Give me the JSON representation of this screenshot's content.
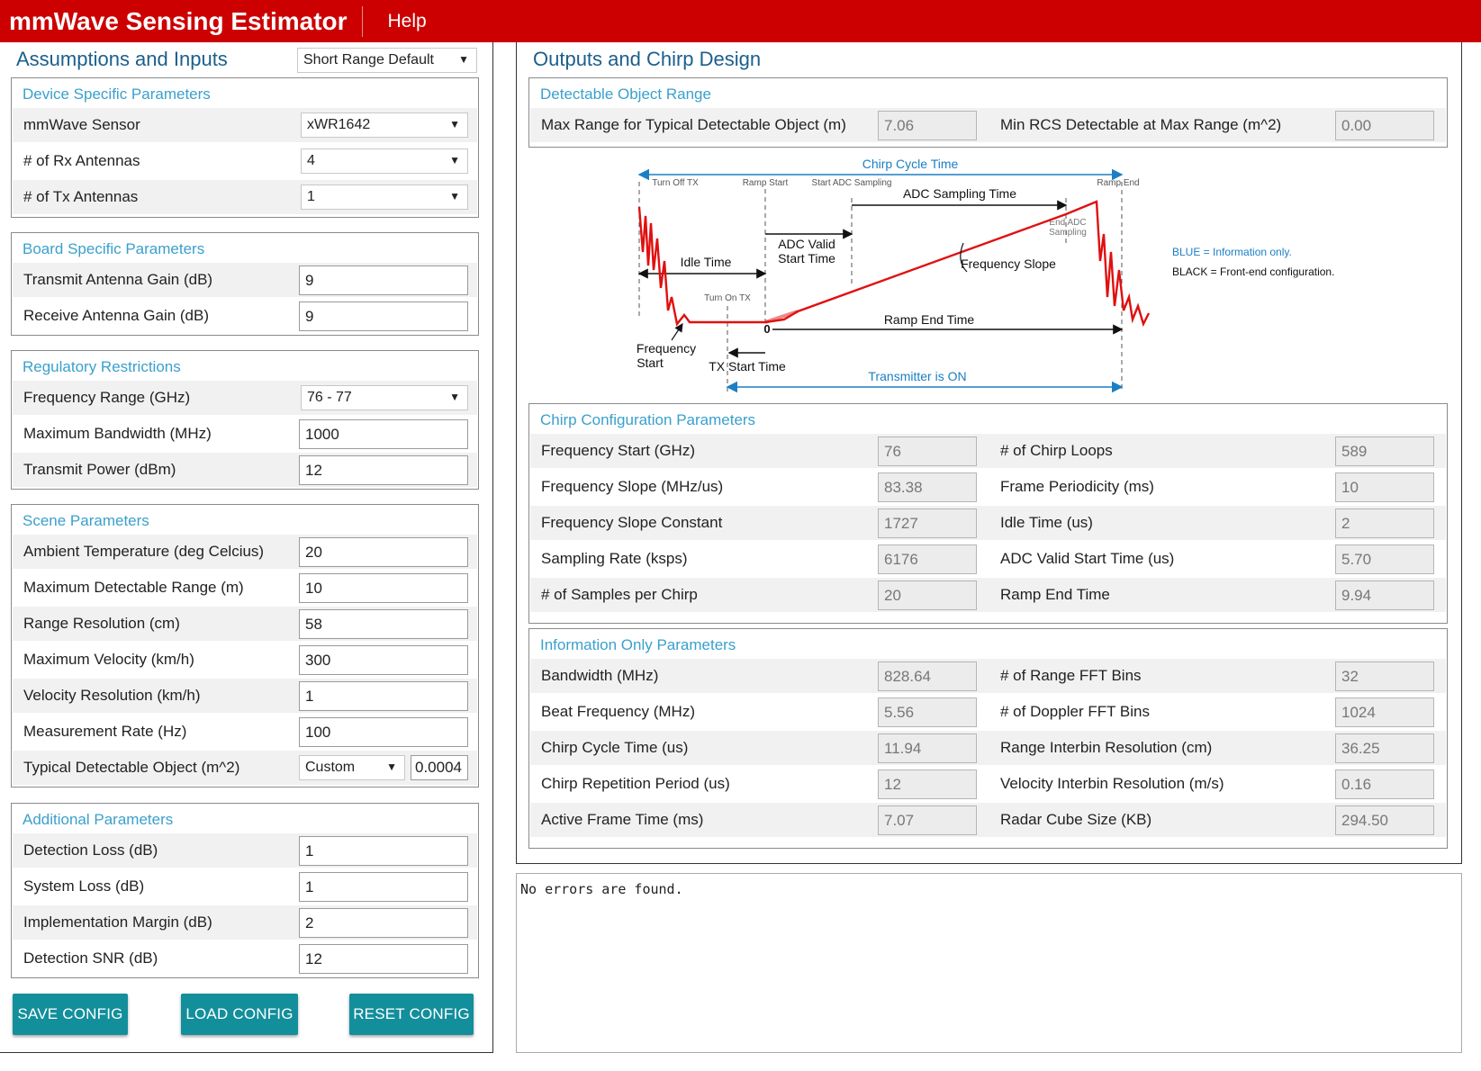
{
  "header": {
    "title": "mmWave Sensing Estimator",
    "help": "Help"
  },
  "left": {
    "title": "Assumptions and Inputs",
    "preset": "Short Range Default",
    "device": {
      "title": "Device Specific Parameters",
      "sensor_label": "mmWave Sensor",
      "sensor_value": "xWR1642",
      "rx_label": "# of Rx Antennas",
      "rx_value": "4",
      "tx_label": "# of Tx Antennas",
      "tx_value": "1"
    },
    "board": {
      "title": "Board Specific Parameters",
      "tx_gain_label": "Transmit Antenna Gain (dB)",
      "tx_gain_value": "9",
      "rx_gain_label": "Receive Antenna Gain (dB)",
      "rx_gain_value": "9"
    },
    "regulatory": {
      "title": "Regulatory Restrictions",
      "freq_label": "Frequency Range (GHz)",
      "freq_value": "76 - 77",
      "bw_label": "Maximum Bandwidth (MHz)",
      "bw_value": "1000",
      "power_label": "Transmit Power (dBm)",
      "power_value": "12"
    },
    "scene": {
      "title": "Scene Parameters",
      "temp_label": "Ambient Temperature (deg Celcius)",
      "temp_value": "20",
      "range_label": "Maximum Detectable Range (m)",
      "range_value": "10",
      "res_label": "Range Resolution (cm)",
      "res_value": "58",
      "vel_label": "Maximum Velocity (km/h)",
      "vel_value": "300",
      "velres_label": "Velocity Resolution (km/h)",
      "velres_value": "1",
      "rate_label": "Measurement Rate (Hz)",
      "rate_value": "100",
      "object_label": "Typical Detectable Object (m^2)",
      "object_select": "Custom",
      "object_value": "0.0004"
    },
    "additional": {
      "title": "Additional Parameters",
      "detloss_label": "Detection Loss (dB)",
      "detloss_value": "1",
      "sysloss_label": "System Loss (dB)",
      "sysloss_value": "1",
      "impl_label": "Implementation Margin (dB)",
      "impl_value": "2",
      "snr_label": "Detection SNR (dB)",
      "snr_value": "12"
    },
    "buttons": {
      "save": "SAVE CONFIG",
      "load": "LOAD CONFIG",
      "reset": "RESET CONFIG"
    }
  },
  "right": {
    "title": "Outputs and Chirp Design",
    "detectable": {
      "title": "Detectable Object Range",
      "maxrange_label": "Max Range for Typical Detectable Object (m)",
      "maxrange_value": "7.06",
      "minrcs_label": "Min RCS Detectable at Max Range (m^2)",
      "minrcs_value": "0.00"
    },
    "diagram": {
      "chirp_cycle": "Chirp Cycle Time",
      "turn_off_tx": "Turn Off TX",
      "ramp_start": "Ramp Start",
      "start_adc": "Start ADC Sampling",
      "ramp_end": "Ramp End",
      "adc_sampling_time": "ADC Sampling Time",
      "end_adc_1": "End ADC",
      "end_adc_2": "Sampling",
      "adc_valid_1": "ADC Valid",
      "adc_valid_2": "Start Time",
      "idle_time": "Idle Time",
      "freq_slope": "Frequency Slope",
      "turn_on_tx": "Turn On TX",
      "zero": "0",
      "ramp_end_time": "Ramp End Time",
      "freq_start_1": "Frequency",
      "freq_start_2": "Start",
      "tx_start_time": "TX Start Time",
      "transmitter_on": "Transmitter is ON",
      "legend_blue": "BLUE = Information only.",
      "legend_black": "BLACK = Front-end configuration."
    },
    "chirp": {
      "title": "Chirp Configuration Parameters",
      "rows": [
        {
          "l": "Frequency Start (GHz)",
          "lv": "76",
          "r": "# of Chirp Loops",
          "rv": "589"
        },
        {
          "l": "Frequency Slope (MHz/us)",
          "lv": "83.38",
          "r": "Frame Periodicity (ms)",
          "rv": "10"
        },
        {
          "l": "Frequency Slope Constant",
          "lv": "1727",
          "r": "Idle Time (us)",
          "rv": "2"
        },
        {
          "l": "Sampling Rate (ksps)",
          "lv": "6176",
          "r": "ADC Valid Start Time (us)",
          "rv": "5.70"
        },
        {
          "l": "# of Samples per Chirp",
          "lv": "20",
          "r": "Ramp End Time",
          "rv": "9.94"
        }
      ]
    },
    "info": {
      "title": "Information Only Parameters",
      "rows": [
        {
          "l": "Bandwidth (MHz)",
          "lv": "828.64",
          "r": "# of Range FFT Bins",
          "rv": "32"
        },
        {
          "l": "Beat Frequency (MHz)",
          "lv": "5.56",
          "r": "# of Doppler FFT Bins",
          "rv": "1024"
        },
        {
          "l": "Chirp Cycle Time (us)",
          "lv": "11.94",
          "r": "Range Interbin Resolution (cm)",
          "rv": "36.25"
        },
        {
          "l": "Chirp Repetition Period (us)",
          "lv": "12",
          "r": "Velocity Interbin Resolution (m/s)",
          "rv": "0.16"
        },
        {
          "l": "Active Frame Time (ms)",
          "lv": "7.07",
          "r": "Radar Cube Size (KB)",
          "rv": "294.50"
        }
      ]
    }
  },
  "status": {
    "message": "No errors are found."
  }
}
